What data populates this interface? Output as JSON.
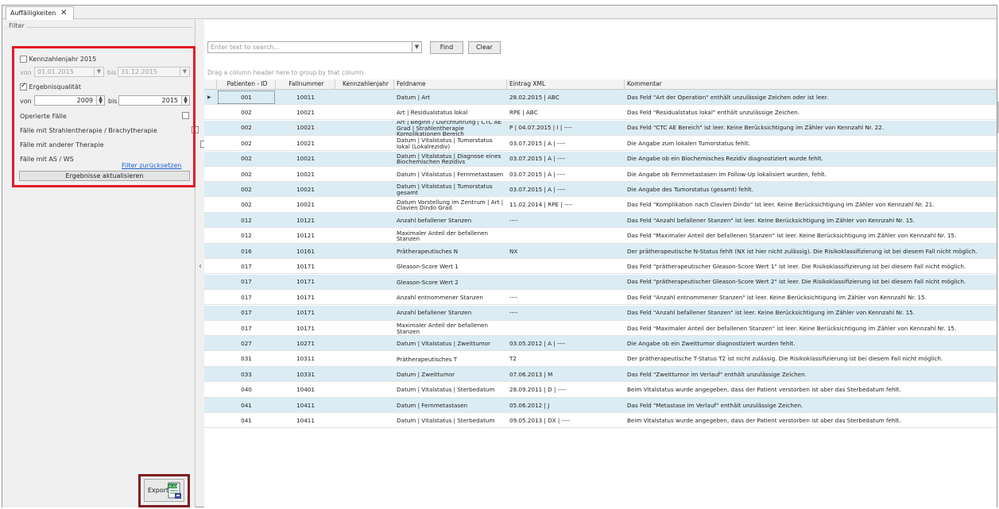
{
  "tab": {
    "title": "Auffälligkeiten",
    "close": "✕"
  },
  "filter": {
    "group_label": "Filter",
    "kennzahlenjahr": {
      "label": "Kennzahlenjahr 2015",
      "checked": false
    },
    "date_from_label": "von",
    "date_from": "01.01.2015",
    "date_to_label": "bis",
    "date_to": "31.12.2015",
    "ergebnisqualitaet": {
      "label": "Ergebnisqualität",
      "checked": true
    },
    "year_from_label": "von",
    "year_from": "2009",
    "year_to_label": "bis",
    "year_to": "2015",
    "options": [
      {
        "label": "Operierte Fälle",
        "checked": false
      },
      {
        "label": "Fälle mit Strahlentherapie / Brachytherapie",
        "checked": false
      },
      {
        "label": "Fälle mit anderer Therapie",
        "checked": false
      },
      {
        "label": "Fälle mit AS / WS",
        "checked": false
      }
    ],
    "reset_link": "Filter zurücksetzen",
    "update_button": "Ergebnisse aktualisieren"
  },
  "export": {
    "label": "Export",
    "icon": "excel-xlsx-icon",
    "icon_text": "XLSX"
  },
  "splitter": "‹",
  "search": {
    "placeholder": "Enter text to search...",
    "find": "Find",
    "clear": "Clear"
  },
  "group_hint": "Drag a column header here to group by that column",
  "columns": [
    "Patienten - ID",
    "Fallnummer",
    "Kennzahlenjahr",
    "Feldname",
    "Eintrag XML",
    "Kommentar"
  ],
  "rows": [
    {
      "id": "001",
      "fall": "10011",
      "jahr": "",
      "feld": "Datum | Art",
      "xml": "28.02.2015 | ABC",
      "kommentar": "Das Feld \"Art der Operation\" enthält unzulässige Zeichen oder ist leer."
    },
    {
      "id": "002",
      "fall": "10021",
      "jahr": "",
      "feld": "Art | Residualstatus lokal",
      "xml": "RPE | ABC",
      "kommentar": "Das Feld \"Residualstatus lokal\" enthält unzulässige Zeichen."
    },
    {
      "id": "002",
      "fall": "10021",
      "jahr": "",
      "feld": "Art | Beginn / Durchführung | CTC AE Grad | Strahlentherapie Komplikationen Bereich",
      "xml": "P | 04.07.2015 | I | ----",
      "kommentar": "Das Feld \"CTC AE Bereich\" ist leer. Keine Berücksichtigung im Zähler von Kennzahl Nr. 22."
    },
    {
      "id": "002",
      "fall": "10021",
      "jahr": "",
      "feld": "Datum | Vitalstatus | Tumorstatus lokal (Lokalrezidiv)",
      "xml": "03.07.2015 | A | ----",
      "kommentar": "Die Angabe zum lokalen Tumorstatus fehlt."
    },
    {
      "id": "002",
      "fall": "10021",
      "jahr": "",
      "feld": "Datum | Vitalstatus | Diagnose eines Biochemischen Rezidivs",
      "xml": "03.07.2015 | A | ----",
      "kommentar": "Die Angabe ob ein Biochemisches Rezidiv diagnostiziert wurde fehlt."
    },
    {
      "id": "002",
      "fall": "10021",
      "jahr": "",
      "feld": "Datum | Vitalstatus | Fernmetastasen",
      "xml": "03.07.2015 | A | ----",
      "kommentar": "Die Angabe ob Fernmetastasen im Follow-Up lokalisiert wurden, fehlt."
    },
    {
      "id": "002",
      "fall": "10021",
      "jahr": "",
      "feld": "Datum | Vitalstatus | Tumorstatus gesamt",
      "xml": "03.07.2015 | A | ----",
      "kommentar": "Die Angabe des Tumorstatus (gesamt) fehlt."
    },
    {
      "id": "002",
      "fall": "10021",
      "jahr": "",
      "feld": "Datum Vorstellung im Zentrum | Art | Clavien Dindo Grad",
      "xml": "11.02.2014 | RPE | ----",
      "kommentar": "Das Feld \"Komplikation nach Clavien Dindo\" ist leer. Keine Berücksichtigung im Zähler von Kennzahl Nr. 21."
    },
    {
      "id": "012",
      "fall": "10121",
      "jahr": "",
      "feld": "Anzahl befallener Stanzen",
      "xml": "----",
      "kommentar": "Das Feld \"Anzahl befallener Stanzen\" ist leer. Keine Berücksichtigung im Zähler von Kennzahl Nr. 15."
    },
    {
      "id": "012",
      "fall": "10121",
      "jahr": "",
      "feld": "Maximaler Anteil der befallenen Stanzen",
      "xml": "",
      "kommentar": "Das Feld \"Maximaler Anteil der befallenen Stanzen\" ist leer. Keine Berücksichtigung im Zähler von Kennzahl Nr. 15."
    },
    {
      "id": "016",
      "fall": "10161",
      "jahr": "",
      "feld": "Prätherapeutisches N",
      "xml": "NX",
      "kommentar": "Der prätherapeutische N-Status fehlt (NX ist hier nicht zulässig). Die Risikoklassifizierung ist bei diesem Fall nicht möglich."
    },
    {
      "id": "017",
      "fall": "10171",
      "jahr": "",
      "feld": "Gleason-Score Wert 1",
      "xml": "",
      "kommentar": "Das Feld \"prätherapeutischer Gleason-Score Wert 1\" ist leer. Die Risikoklassifizierung ist bei diesem Fall nicht möglich."
    },
    {
      "id": "017",
      "fall": "10171",
      "jahr": "",
      "feld": "Gleason-Score Wert 2",
      "xml": "",
      "kommentar": "Das Feld \"prätherapeutischer Gleason-Score Wert 2\" ist leer. Die Risikoklassifizierung ist bei diesem Fall nicht möglich."
    },
    {
      "id": "017",
      "fall": "10171",
      "jahr": "",
      "feld": "Anzahl entnommener Stanzen",
      "xml": "----",
      "kommentar": "Das Feld \"Anzahl entnommener Stanzen\" ist leer. Keine Berücksichtigung im Zähler von Kennzahl Nr. 15."
    },
    {
      "id": "017",
      "fall": "10171",
      "jahr": "",
      "feld": "Anzahl befallener Stanzen",
      "xml": "----",
      "kommentar": "Das Feld \"Anzahl befallener Stanzen\" ist leer. Keine Berücksichtigung im Zähler von Kennzahl Nr. 15."
    },
    {
      "id": "017",
      "fall": "10171",
      "jahr": "",
      "feld": "Maximaler Anteil der befallenen Stanzen",
      "xml": "",
      "kommentar": "Das Feld \"Maximaler Anteil der befallenen Stanzen\" ist leer. Keine Berücksichtigung im Zähler von Kennzahl Nr. 15."
    },
    {
      "id": "027",
      "fall": "10271",
      "jahr": "",
      "feld": "Datum | Vitalstatus | Zweittumor",
      "xml": "03.05.2012 | A | ----",
      "kommentar": "Die Angabe ob ein Zweittumor diagnostiziert wurden fehlt."
    },
    {
      "id": "031",
      "fall": "10311",
      "jahr": "",
      "feld": "Prätherapeutisches T",
      "xml": "T2",
      "kommentar": "Der prätherapeutische T-Status T2 ist nicht zulässig. Die Risikoklassifizierung ist bei diesem Fall nicht möglich."
    },
    {
      "id": "033",
      "fall": "10331",
      "jahr": "",
      "feld": "Datum | Zweittumor",
      "xml": "07.06.2013 | M",
      "kommentar": "Das Feld \"Zweittumor im  Verlauf\" enthält unzulässige Zeichen."
    },
    {
      "id": "040",
      "fall": "10401",
      "jahr": "",
      "feld": "Datum | Vitalstatus | Sterbedatum",
      "xml": "28.09.2011 | D | ----",
      "kommentar": "Beim Vitalstatus wurde angegeben, dass der Patient verstorben ist aber das Sterbedatum fehlt."
    },
    {
      "id": "041",
      "fall": "10411",
      "jahr": "",
      "feld": "Datum | Fernmetastasen",
      "xml": "05.06.2012 | J",
      "kommentar": "Das Feld \"Metastase im Verlauf\" enthält unzulässige Zeichen."
    },
    {
      "id": "041",
      "fall": "10411",
      "jahr": "",
      "feld": "Datum | Vitalstatus | Sterbedatum",
      "xml": "09.05.2013 | DX | ----",
      "kommentar": "Beim Vitalstatus wurde angegeben, dass der Patient verstorben ist aber das Sterbedatum fehlt."
    }
  ],
  "colors": {
    "row_alt": "#dbecf4",
    "highlight_red": "#e21d2b",
    "highlight_dark_red": "#7d1e22",
    "link": "#1a5fd0"
  }
}
